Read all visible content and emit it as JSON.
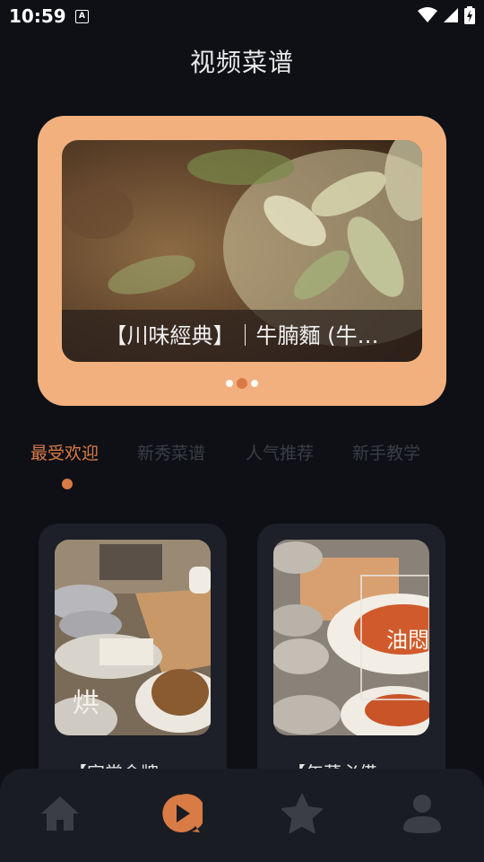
{
  "status_bar": {
    "time": "10:59",
    "a_badge": "A"
  },
  "header": {
    "title": "视频菜谱"
  },
  "banner": {
    "caption": "【川味經典】｜牛腩麵 (牛…",
    "slide_count": 3,
    "active_slide": 2,
    "background_color": "#f2b07f"
  },
  "tabs": [
    {
      "label": "最受欢迎",
      "active": true
    },
    {
      "label": "新秀菜谱",
      "active": false
    },
    {
      "label": "人气推荐",
      "active": false
    },
    {
      "label": "新手教学",
      "active": false
    }
  ],
  "cards": [
    {
      "title": "【家常金牌",
      "image_text": "烘"
    },
    {
      "title": "【年菜必備",
      "image_text": "油悶"
    }
  ],
  "bottom_nav": [
    {
      "icon": "home-icon",
      "active": false
    },
    {
      "icon": "play-video-icon",
      "active": true
    },
    {
      "icon": "star-icon",
      "active": false
    },
    {
      "icon": "user-icon",
      "active": false
    }
  ],
  "colors": {
    "accent": "#d97b45",
    "background": "#0e1016",
    "card": "#1d2029",
    "nav": "#1a1c23",
    "inactive_icon": "#3b3e47"
  }
}
